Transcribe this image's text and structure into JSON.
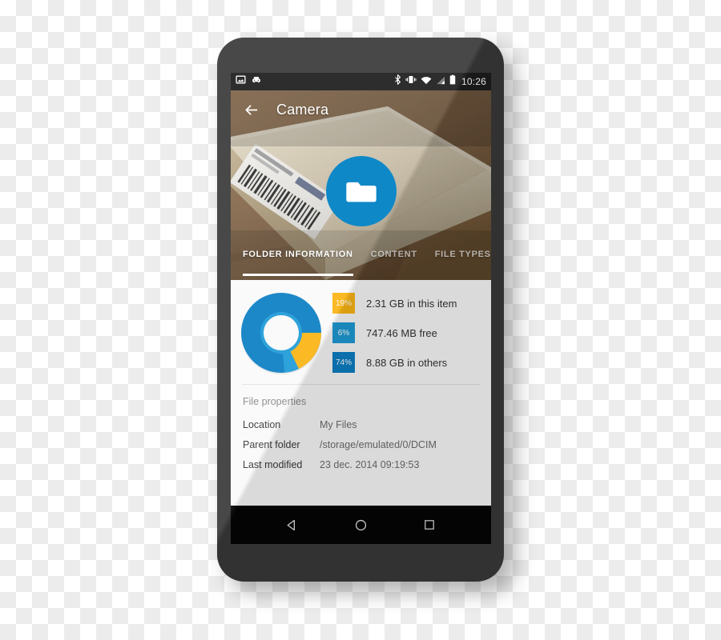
{
  "device": {
    "frame_color": "#3a3a3a"
  },
  "statusbar": {
    "time": "10:26",
    "notification_icons": [
      "image-icon",
      "car-icon"
    ],
    "system_icons": [
      "bluetooth-icon",
      "vibrate-icon",
      "wifi-icon",
      "signal-icon",
      "battery-icon"
    ]
  },
  "toolbar": {
    "back_label": "Back",
    "title": "Camera"
  },
  "header": {
    "folder_icon": "folder-icon",
    "accent": "#0f88c8"
  },
  "tabs": [
    {
      "label": "FOLDER INFORMATION",
      "active": true
    },
    {
      "label": "CONTENT",
      "active": false
    },
    {
      "label": "FILE TYPES",
      "active": false
    }
  ],
  "chart_data": {
    "type": "pie",
    "title": "",
    "categories": [
      "2.31 GB in this item",
      "747.46 MB free",
      "8.88 GB in others"
    ],
    "values": [
      19,
      6,
      74
    ],
    "value_labels": [
      "19%",
      "6%",
      "74%"
    ],
    "colors": [
      "#fbb514",
      "#1e9bd7",
      "#0c7fc4"
    ],
    "donut": true,
    "legend_position": "right"
  },
  "legend": [
    {
      "percent": "19%",
      "color": "#fbb514",
      "label": "2.31 GB in this item"
    },
    {
      "percent": "6%",
      "color": "#1e9bd7",
      "label": "747.46 MB free"
    },
    {
      "percent": "74%",
      "color": "#0c7fc4",
      "label": "8.88 GB in others"
    }
  ],
  "properties": {
    "title": "File properties",
    "rows": [
      {
        "key": "Location",
        "value": "My Files"
      },
      {
        "key": "Parent folder",
        "value": "/storage/emulated/0/DCIM"
      },
      {
        "key": "Last modified",
        "value": "23 dec. 2014 09:19:53"
      }
    ]
  },
  "navbar": {
    "back": "back-triangle-icon",
    "home": "home-circle-icon",
    "recents": "recents-square-icon"
  }
}
